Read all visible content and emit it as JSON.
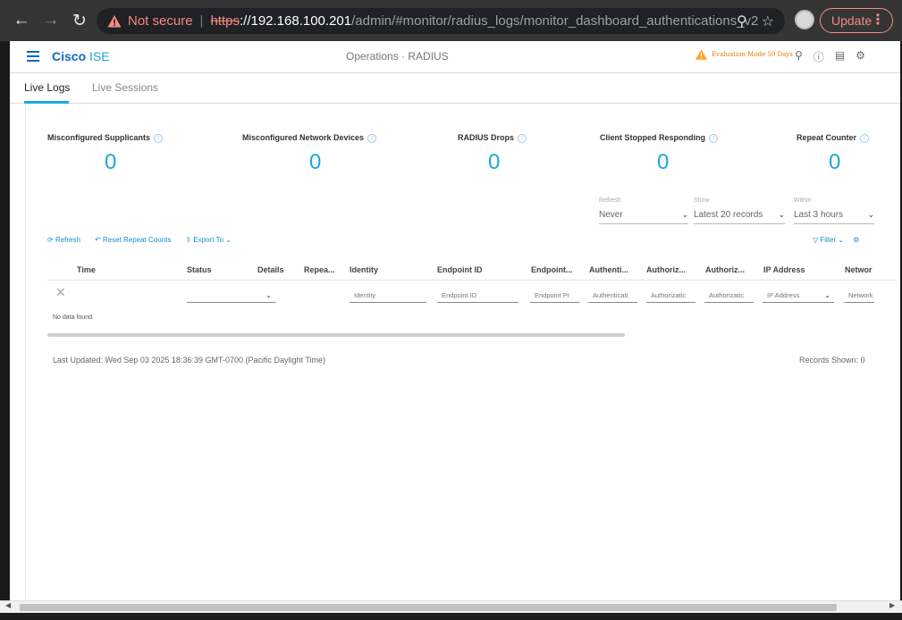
{
  "browser": {
    "not_secure": "Not secure",
    "protocol": "https",
    "url_host": "://192.168.100.201",
    "url_path": "/admin/#monitor/radius_logs/monitor_dashboard_authentications_v2",
    "update_label": "Update"
  },
  "header": {
    "brand_cisco": "Cisco",
    "brand_ise": "ISE",
    "page_title": "Operations · RADIUS",
    "eval_mode": "Evaluation Mode 50 Days"
  },
  "tabs": [
    {
      "label": "Live Logs"
    },
    {
      "label": "Live Sessions"
    }
  ],
  "counters": [
    {
      "label": "Misconfigured Supplicants",
      "value": "0"
    },
    {
      "label": "Misconfigured Network Devices",
      "value": "0"
    },
    {
      "label": "RADIUS Drops",
      "value": "0"
    },
    {
      "label": "Client Stopped Responding",
      "value": "0"
    },
    {
      "label": "Repeat Counter",
      "value": "0"
    }
  ],
  "filters": {
    "refresh_label": "Refresh",
    "refresh_value": "Never",
    "show_label": "Show",
    "show_value": "Latest 20 records",
    "within_label": "Within",
    "within_value": "Last 3 hours"
  },
  "toolbar": {
    "refresh": "Refresh",
    "reset": "Reset Repeat Counts",
    "export": "Export To",
    "filter": "Filter"
  },
  "table": {
    "columns": [
      "Time",
      "Status",
      "Details",
      "Repea...",
      "Identity",
      "Endpoint ID",
      "Endpoint...",
      "Authenti...",
      "Authoriz...",
      "Authoriz...",
      "IP Address",
      "Networ"
    ],
    "filter_placeholders": {
      "identity": "Identity",
      "endpoint_id": "Endpoint ID",
      "endpoint_profile": "Endpoint Pr",
      "authentication": "Authenticati",
      "authorization_1": "Authorizatic",
      "authorization_2": "Authorizatic",
      "ip_address": "IP Address",
      "network": "Network"
    },
    "no_data": "No data found."
  },
  "footer": {
    "last_updated": "Last Updated: Wed Sep 03 2025 18:36:39 GMT-0700 (Pacific Daylight Time)",
    "records_shown": "Records Shown: 0"
  },
  "colors": {
    "accent": "#1aa7e0",
    "brand": "#0d6bbf",
    "warning": "#e07b00"
  }
}
